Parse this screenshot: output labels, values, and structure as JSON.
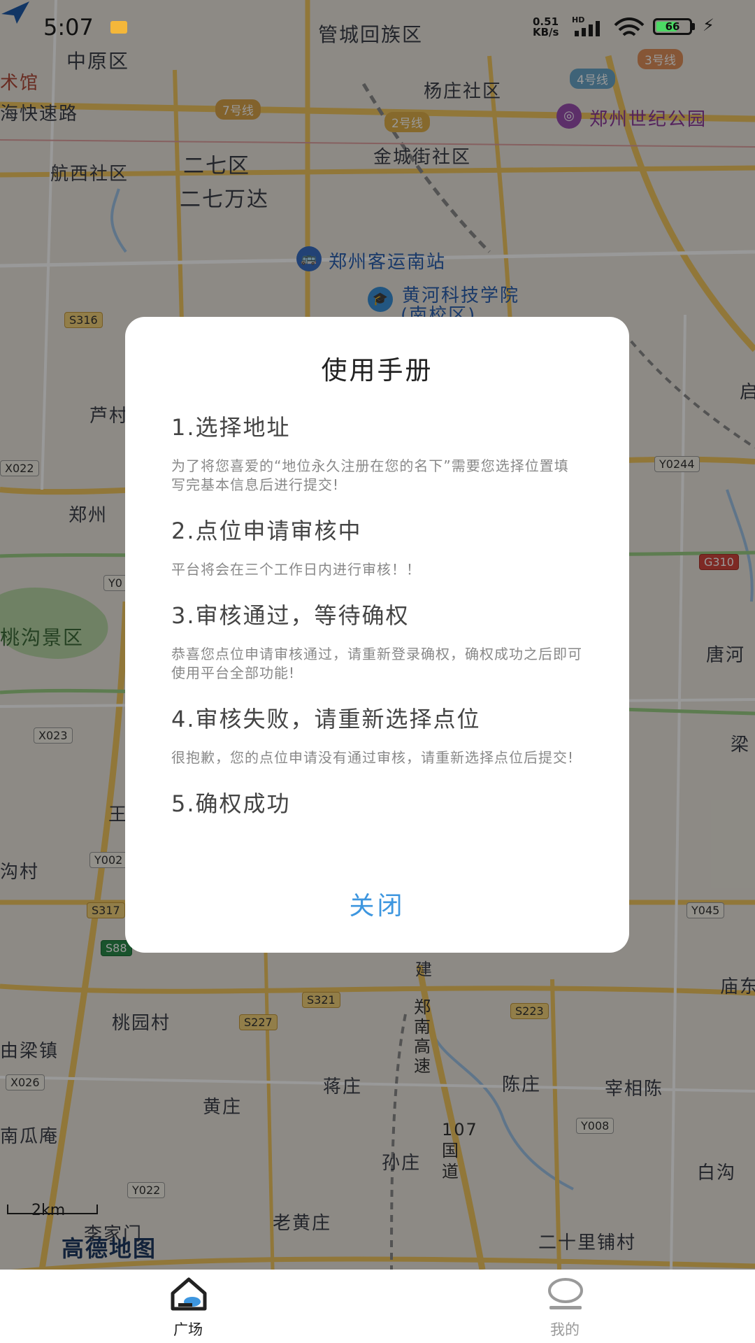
{
  "status_bar": {
    "time": "5:07",
    "network_speed": "0.51 KB/s",
    "hd_label": "HD",
    "battery_level": 66,
    "battery_text": "66"
  },
  "map": {
    "labels": [
      {
        "name": "管城回族区"
      },
      {
        "name": "中原区"
      },
      {
        "name": "术馆"
      },
      {
        "name": "杨庄社区"
      },
      {
        "name": "郑州世纪公园"
      },
      {
        "name": "航西社区"
      },
      {
        "name": "二七区"
      },
      {
        "name": "金城街社区"
      },
      {
        "name": "二七万达"
      },
      {
        "name": "郑州客运南站"
      },
      {
        "name": "黄河科技学院"
      },
      {
        "name": "(南校区)"
      },
      {
        "name": "芦村"
      },
      {
        "name": "郑州"
      },
      {
        "name": "唐河"
      },
      {
        "name": "梁"
      },
      {
        "name": "沟村"
      },
      {
        "name": "桃园村"
      },
      {
        "name": "庙东"
      },
      {
        "name": "由梁镇"
      },
      {
        "name": "蒋庄"
      },
      {
        "name": "陈庄"
      },
      {
        "name": "宰相陈"
      },
      {
        "name": "黄庄"
      },
      {
        "name": "南瓜庵"
      },
      {
        "name": "孙庄"
      },
      {
        "name": "白沟"
      },
      {
        "name": "老黄庄"
      },
      {
        "name": "二十里铺村"
      },
      {
        "name": "李家门"
      },
      {
        "name": "郑南高速"
      },
      {
        "name": "107国道"
      },
      {
        "name": "建"
      },
      {
        "name": "桃沟景区"
      },
      {
        "name": "海快速路"
      },
      {
        "name": "启"
      },
      {
        "name": "王"
      }
    ],
    "road_badges": [
      "S316",
      "X022",
      "Y0244",
      "G310",
      "X023",
      "Y0",
      "S317",
      "S88",
      "Y002",
      "Y045",
      "S321",
      "S227",
      "S223",
      "X026",
      "Y008",
      "Y022"
    ],
    "metro_badges": [
      "7号线",
      "2号线",
      "4号线",
      "3号线"
    ],
    "scale": "2km",
    "logo": "高德地图"
  },
  "dialog": {
    "title": "使用手册",
    "steps": [
      {
        "title": "1.选择地址",
        "desc": "为了将您喜爱的“地位永久注册在您的名下”需要您选择位置填写完基本信息后进行提交!"
      },
      {
        "title": "2.点位申请审核中",
        "desc": "平台将会在三个工作日内进行审核！！"
      },
      {
        "title": "3.审核通过，等待确权",
        "desc": "恭喜您点位申请审核通过，请重新登录确权，确权成功之后即可使用平台全部功能!"
      },
      {
        "title": "4.审核失败，请重新选择点位",
        "desc": "很抱歉，您的点位申请没有通过审核，请重新选择点位后提交!"
      },
      {
        "title": "5.确权成功",
        "desc": ""
      }
    ],
    "close_label": "关闭"
  },
  "nav": {
    "tabs": [
      {
        "label": "广场",
        "active": true
      },
      {
        "label": "我的",
        "active": false
      }
    ]
  },
  "colors": {
    "accent": "#3d96df",
    "dialog_bg": "#ffffff",
    "overlay": "rgba(0,0,0,0.4)"
  }
}
